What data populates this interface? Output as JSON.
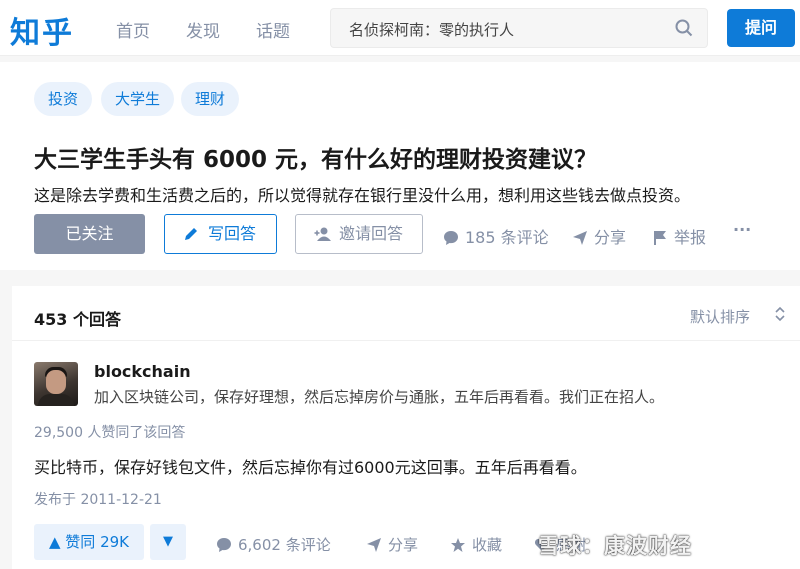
{
  "header": {
    "logo": "知乎",
    "nav": [
      "首页",
      "发现",
      "话题"
    ],
    "search_value": "名侦探柯南：零的执行人",
    "ask_label": "提问"
  },
  "question": {
    "tags": [
      "投资",
      "大学生",
      "理财"
    ],
    "title": "大三学生手头有 6000 元，有什么好的理财投资建议？",
    "description": "这是除去学费和生活费之后的，所以觉得就存在银行里没什么用，想利用这些钱去做点投资。",
    "follow_label": "已关注",
    "write_label": "写回答",
    "invite_label": "邀请回答",
    "comments": "185 条评论",
    "share": "分享",
    "report": "举报",
    "more": "···"
  },
  "answers": {
    "count_label": "453 个回答",
    "sort_label": "默认排序",
    "first": {
      "author": "blockchain",
      "headline": "加入区块链公司，保存好理想，然后忘掉房价与通胀，五年后再看看。我们正在招人。",
      "votes_text": "29,500 人赞同了该回答",
      "content": "买比特币，保存好钱包文件，然后忘掉你有过6000元这回事。五年后再看看。",
      "published": "发布于 2011-12-21",
      "upvote_label": "▲ 赞同 29K",
      "downvote_label": "▼",
      "comments": "6,602 条评论",
      "share": "分享",
      "collect": "收藏",
      "thanks": "感谢"
    }
  },
  "watermark": "雪球：康波财经",
  "colors": {
    "brand": "#0e7bd8",
    "muted": "#8590a6",
    "tag_bg": "#eaf2fc"
  }
}
